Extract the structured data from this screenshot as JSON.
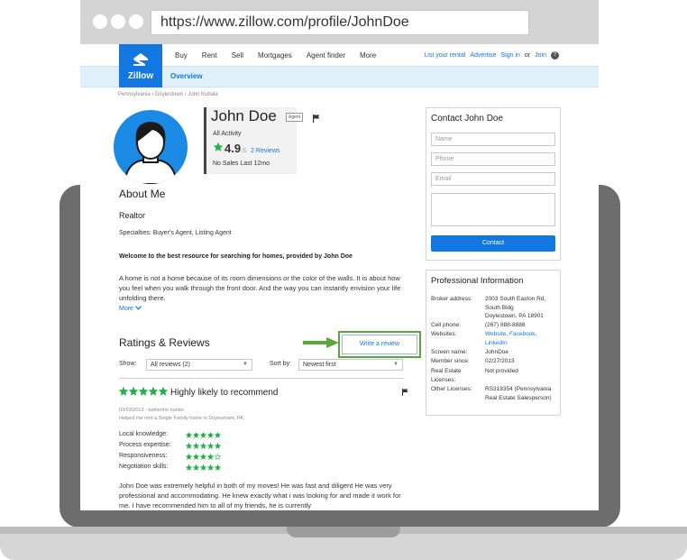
{
  "browser": {
    "url": "https://www.zillow.com/profile/JohnDoe"
  },
  "nav": {
    "logo_text": "Zillow",
    "links": [
      "Buy",
      "Rent",
      "Sell",
      "Mortgages",
      "Agent finder",
      "More"
    ],
    "list_rental": "List your rental",
    "advertise": "Advertise",
    "sign_in": "Sign in",
    "or": "or",
    "join": "Join",
    "help": "?"
  },
  "subnav": {
    "overview": "Overview"
  },
  "breadcrumb": "Pennsylvania › Doylestown › John Kubala",
  "profile": {
    "name": "John Doe",
    "badge": "Agent",
    "all_activity": "All Activity",
    "rating": "4.9",
    "rating_max": "/5",
    "reviews_link": "2 Reviews",
    "no_sales": "No Sales Last 12mo",
    "star_color": "#21b04b"
  },
  "about": {
    "title": "About Me",
    "role": "Realtor",
    "specialties": "Specialties: Buyer's Agent, Listing Agent",
    "welcome": "Welcome to the best resource for searching for homes, provided by John Doe",
    "description": "A home is not a home because of its room dimensions or the color of the walls. It is about how you feel when you walk through the front door. And the way you can instantly envision your life unfolding there.",
    "more": "More"
  },
  "ratings": {
    "title": "Ratings & Reviews",
    "write_review": "Write a review",
    "show_label": "Show:",
    "show_value": "All reviews (2)",
    "sort_label": "Sort by:",
    "sort_value": "Newest first"
  },
  "review": {
    "stars": 5,
    "headline": "Highly likely to recommend",
    "meta": "03/03/2013 - katherine hunter",
    "sub": "Helped me rent a Single Family home in Doylestown, PA.",
    "subratings": [
      {
        "label": "Local knowledge:",
        "stars": 5
      },
      {
        "label": "Process expertise:",
        "stars": 5
      },
      {
        "label": "Responsiveness:",
        "stars": 4
      },
      {
        "label": "Negotiation skills:",
        "stars": 5
      }
    ],
    "body": "John Doe was extremely helpful in both of my moves! He was fast and diligent He was very professional and accommodating. He knew exactly what i was looking for and made it work for me. I have recommended him to all of my friends, he is currently"
  },
  "contact": {
    "title": "Contact John Doe",
    "name_placeholder": "Name",
    "phone_placeholder": "Phone",
    "email_placeholder": "Email",
    "button": "Contact"
  },
  "professional": {
    "title": "Professional Information",
    "broker_label": "Broker address:",
    "broker_lines": [
      "2003 South Easton Rd,",
      "South Bldg",
      "Doylestown, PA  18901"
    ],
    "cell_label": "Cell phone:",
    "cell_value": "(267) 888-8888",
    "websites_label": "Websites:",
    "website": "Website",
    "facebook": "Facebook",
    "linkedin": "LinkedIn",
    "screen_label": "Screen name:",
    "screen_value": "JohnDoe",
    "member_label": "Member since:",
    "member_value": "02/27/2013",
    "re_license_label": "Real Estate Licenses:",
    "re_license_value": "Not provided",
    "other_label": "Other Licenses:",
    "other_value": "RS319354 (Pennsylvania Real Estate Salesperson)"
  }
}
